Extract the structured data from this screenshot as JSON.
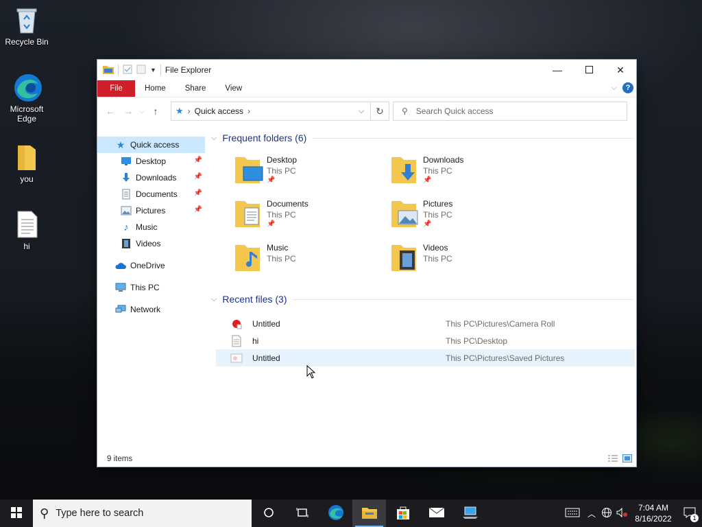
{
  "desktop": {
    "icons": [
      {
        "label": "Recycle Bin",
        "icon": "recycle-bin-icon"
      },
      {
        "label": "Microsoft Edge",
        "icon": "edge-icon"
      },
      {
        "label": "you",
        "icon": "folder-icon"
      },
      {
        "label": "hi",
        "icon": "text-file-icon"
      }
    ]
  },
  "window": {
    "title": "File Explorer",
    "ribbon_tabs": [
      "File",
      "Home",
      "Share",
      "View"
    ],
    "help_label": "?",
    "address": {
      "current": "Quick access"
    },
    "search_placeholder": "Search Quick access",
    "sidebar": {
      "items": [
        {
          "label": "Quick access",
          "icon": "star-icon",
          "selected": true
        },
        {
          "label": "Desktop",
          "icon": "desktop-icon",
          "pinned": true
        },
        {
          "label": "Downloads",
          "icon": "download-arrow-icon",
          "pinned": true
        },
        {
          "label": "Documents",
          "icon": "documents-icon",
          "pinned": true
        },
        {
          "label": "Pictures",
          "icon": "pictures-icon",
          "pinned": true
        },
        {
          "label": "Music",
          "icon": "music-note-icon"
        },
        {
          "label": "Videos",
          "icon": "film-icon"
        },
        {
          "label": "OneDrive",
          "icon": "cloud-icon"
        },
        {
          "label": "This PC",
          "icon": "computer-icon"
        },
        {
          "label": "Network",
          "icon": "network-icon"
        }
      ]
    },
    "frequent": {
      "header": "Frequent folders (6)",
      "folders": [
        {
          "name": "Desktop",
          "location": "This PC",
          "pinned": true
        },
        {
          "name": "Downloads",
          "location": "This PC",
          "pinned": true
        },
        {
          "name": "Documents",
          "location": "This PC",
          "pinned": true
        },
        {
          "name": "Pictures",
          "location": "This PC",
          "pinned": true
        },
        {
          "name": "Music",
          "location": "This PC",
          "pinned": false
        },
        {
          "name": "Videos",
          "location": "This PC",
          "pinned": false
        }
      ]
    },
    "recent": {
      "header": "Recent files (3)",
      "files": [
        {
          "name": "Untitled",
          "path": "This PC\\Pictures\\Camera Roll",
          "icon": "paint-image-icon"
        },
        {
          "name": "hi",
          "path": "This PC\\Desktop",
          "icon": "text-file-icon"
        },
        {
          "name": "Untitled",
          "path": "This PC\\Pictures\\Saved Pictures",
          "icon": "image-file-icon"
        }
      ]
    },
    "status": "9 items"
  },
  "taskbar": {
    "search_placeholder": "Type here to search",
    "time": "7:04 AM",
    "date": "8/16/2022",
    "notification_count": "1"
  },
  "colors": {
    "file_tab": "#cf1f2b",
    "selection": "#cce8ff",
    "hover_row": "#e5f3ff",
    "group_header": "#1e3287"
  }
}
